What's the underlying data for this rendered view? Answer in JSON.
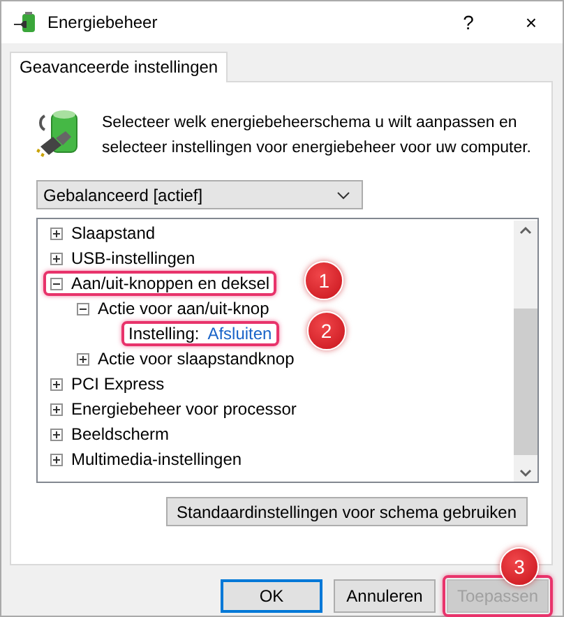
{
  "window": {
    "title": "Energiebeheer",
    "help": "?",
    "close": "×"
  },
  "tabs": [
    {
      "label": "Geavanceerde instellingen",
      "selected": true
    }
  ],
  "intro": "Selecteer welk energiebeheerschema u wilt aanpassen en selecteer instellingen voor energiebeheer voor uw computer.",
  "scheme": {
    "value": "Gebalanceerd [actief]"
  },
  "tree": {
    "items": [
      {
        "label": "Slaapstand",
        "expanded": false,
        "highlighted": false
      },
      {
        "label": "USB-instellingen",
        "expanded": false,
        "highlighted": false
      },
      {
        "label": "Aan/uit-knoppen en deksel",
        "expanded": true,
        "highlighted": true,
        "badge": "1",
        "children": [
          {
            "label": "Actie voor aan/uit-knop",
            "expanded": true,
            "highlighted": false,
            "children": [
              {
                "kind": "setting",
                "label": "Instelling:",
                "value": "Afsluiten",
                "highlighted": true,
                "badge": "2"
              }
            ]
          },
          {
            "label": "Actie voor slaapstandknop",
            "expanded": false,
            "highlighted": false
          }
        ]
      },
      {
        "label": "PCI Express",
        "expanded": false,
        "highlighted": false
      },
      {
        "label": "Energiebeheer voor processor",
        "expanded": false,
        "highlighted": false
      },
      {
        "label": "Beeldscherm",
        "expanded": false,
        "highlighted": false
      },
      {
        "label": "Multimedia-instellingen",
        "expanded": false,
        "highlighted": false
      }
    ]
  },
  "restore_button": {
    "label": "Standaardinstellingen voor schema gebruiken"
  },
  "buttons": [
    {
      "label": "OK",
      "default": true,
      "disabled": false,
      "highlighted": false
    },
    {
      "label": "Annuleren",
      "default": false,
      "disabled": false,
      "highlighted": false
    },
    {
      "label": "Toepassen",
      "default": false,
      "disabled": true,
      "highlighted": true,
      "badge": "3"
    }
  ]
}
